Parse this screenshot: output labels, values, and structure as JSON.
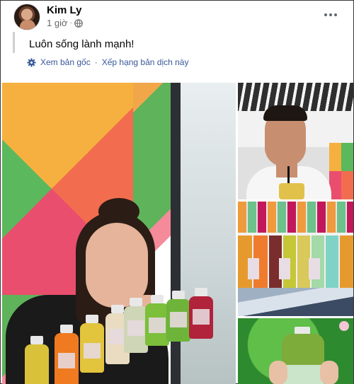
{
  "post": {
    "author": "Kim Ly",
    "time": "1 giờ",
    "dot": "·",
    "text": "Luôn sống lành mạnh!",
    "translation": {
      "view_original": "Xem bản gốc",
      "separator": "·",
      "rate": "Xếp hạng bản dịch này"
    }
  },
  "icons": {
    "privacy": "globe-icon",
    "options": "more-options-icon",
    "translate": "gear-icon"
  },
  "colors": {
    "link": "#385898",
    "meta": "#65676b",
    "text": "#050505"
  }
}
